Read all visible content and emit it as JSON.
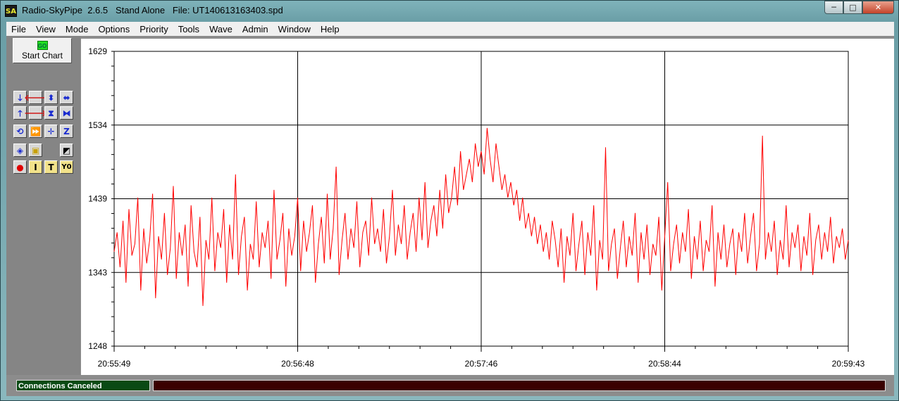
{
  "window": {
    "icon_text": "SA",
    "title": "Radio-SkyPipe  2.6.5   Stand Alone   File: UT140613163403.spd",
    "controls": {
      "minimize": "─",
      "maximize": "□",
      "close": "✕"
    }
  },
  "menu": [
    "File",
    "View",
    "Mode",
    "Options",
    "Priority",
    "Tools",
    "Wave",
    "Admin",
    "Window",
    "Help"
  ],
  "toolbar": {
    "start_icon_text": "GO",
    "start_label": "Start Chart",
    "buttons": [
      {
        "name": "scroll-down-icon",
        "glyph": "🡓",
        "color": "#1a2bd0"
      },
      {
        "name": "scroll-left-icon",
        "glyph": "🡐",
        "color": "#d01818"
      },
      {
        "name": "expand-vertical-icon",
        "glyph": "⬍",
        "color": "#1a2bd0"
      },
      {
        "name": "expand-horizontal-icon",
        "glyph": "⬌",
        "color": "#1a2bd0"
      },
      {
        "name": "scroll-up-icon",
        "glyph": "🡑",
        "color": "#1a2bd0"
      },
      {
        "name": "scroll-right-icon",
        "glyph": "🡒",
        "color": "#d01818"
      },
      {
        "name": "compress-vertical-icon",
        "glyph": "⧗",
        "color": "#1a2bd0"
      },
      {
        "name": "compress-horizontal-icon",
        "glyph": "⧓",
        "color": "#1a2bd0"
      },
      {
        "name": "refresh-icon",
        "glyph": "⟲",
        "color": "#1a2bd0"
      },
      {
        "name": "fast-forward-icon",
        "glyph": "⏩",
        "color": "#9a9a9a"
      },
      {
        "name": "crosshair-icon",
        "glyph": "✛",
        "color": "#1a2bd0"
      },
      {
        "name": "zoom-box-icon",
        "glyph": "Z",
        "color": "#1a2bd0"
      },
      {
        "name": "zoom-fit-icon",
        "glyph": "◈",
        "color": "#1a2bd0"
      },
      {
        "name": "select-region-icon",
        "glyph": "▣",
        "color": "#c8a000"
      },
      {
        "name": "clear-marker-icon",
        "glyph": "◩",
        "color": "#000000"
      },
      {
        "name": "record-icon",
        "glyph": "●",
        "color": "#e00000"
      },
      {
        "name": "insert-text-icon",
        "glyph": "I",
        "color": "#000000"
      },
      {
        "name": "text-tool-icon",
        "glyph": "T",
        "color": "#000000"
      },
      {
        "name": "y-zero-icon",
        "glyph": "Y0",
        "color": "#000000"
      }
    ]
  },
  "status": {
    "left": "Connections Canceled",
    "right": ""
  },
  "chart_data": {
    "type": "line",
    "ylim": [
      1248,
      1629
    ],
    "y_ticks": [
      "1629",
      "1534",
      "1439",
      "1343",
      "1248"
    ],
    "x_ticks": [
      "20:55:49",
      "20:56:48",
      "20:57:46",
      "20:58:44",
      "20:59:43"
    ],
    "x_range_seconds": [
      0,
      234
    ],
    "grid": true,
    "series_color": "#ff0000",
    "series": [
      {
        "values": [
          1370,
          1395,
          1350,
          1410,
          1330,
          1425,
          1365,
          1380,
          1440,
          1320,
          1400,
          1355,
          1385,
          1445,
          1310,
          1390,
          1360,
          1420,
          1340,
          1375,
          1455,
          1335,
          1395,
          1365,
          1405,
          1325,
          1430,
          1370,
          1350,
          1415,
          1300,
          1385,
          1360,
          1440,
          1345,
          1395,
          1375,
          1425,
          1330,
          1405,
          1360,
          1470,
          1340,
          1390,
          1415,
          1320,
          1380,
          1360,
          1435,
          1350,
          1395,
          1375,
          1410,
          1335,
          1450,
          1360,
          1385,
          1420,
          1325,
          1400,
          1365,
          1390,
          1440,
          1345,
          1410,
          1370,
          1395,
          1430,
          1330,
          1380,
          1415,
          1355,
          1445,
          1360,
          1400,
          1480,
          1340,
          1385,
          1420,
          1360,
          1400,
          1375,
          1435,
          1350,
          1395,
          1410,
          1365,
          1440,
          1380,
          1400,
          1370,
          1425,
          1355,
          1390,
          1450,
          1365,
          1405,
          1380,
          1430,
          1360,
          1395,
          1420,
          1370,
          1440,
          1385,
          1460,
          1375,
          1410,
          1430,
          1390,
          1450,
          1400,
          1470,
          1420,
          1440,
          1480,
          1430,
          1500,
          1450,
          1470,
          1490,
          1460,
          1510,
          1480,
          1500,
          1470,
          1530,
          1490,
          1460,
          1510,
          1480,
          1450,
          1470,
          1440,
          1460,
          1430,
          1450,
          1410,
          1440,
          1400,
          1420,
          1390,
          1415,
          1380,
          1405,
          1370,
          1395,
          1360,
          1410,
          1385,
          1350,
          1400,
          1330,
          1390,
          1365,
          1420,
          1345,
          1380,
          1410,
          1340,
          1395,
          1365,
          1430,
          1320,
          1385,
          1360,
          1505,
          1345,
          1380,
          1400,
          1335,
          1375,
          1410,
          1350,
          1390,
          1365,
          1420,
          1330,
          1395,
          1360,
          1405,
          1340,
          1380,
          1365,
          1415,
          1320,
          1390,
          1460,
          1345,
          1380,
          1405,
          1355,
          1395,
          1370,
          1425,
          1335,
          1390,
          1360,
          1410,
          1345,
          1385,
          1370,
          1430,
          1325,
          1395,
          1360,
          1405,
          1350,
          1380,
          1400,
          1340,
          1395,
          1370,
          1420,
          1355,
          1390,
          1420,
          1345,
          1380,
          1520,
          1360,
          1395,
          1370,
          1410,
          1340,
          1385,
          1360,
          1430,
          1350,
          1395,
          1375,
          1405,
          1345,
          1390,
          1365,
          1420,
          1340,
          1385,
          1405,
          1360,
          1395,
          1370,
          1415,
          1355,
          1390,
          1375,
          1400,
          1360,
          1385
        ]
      }
    ]
  }
}
